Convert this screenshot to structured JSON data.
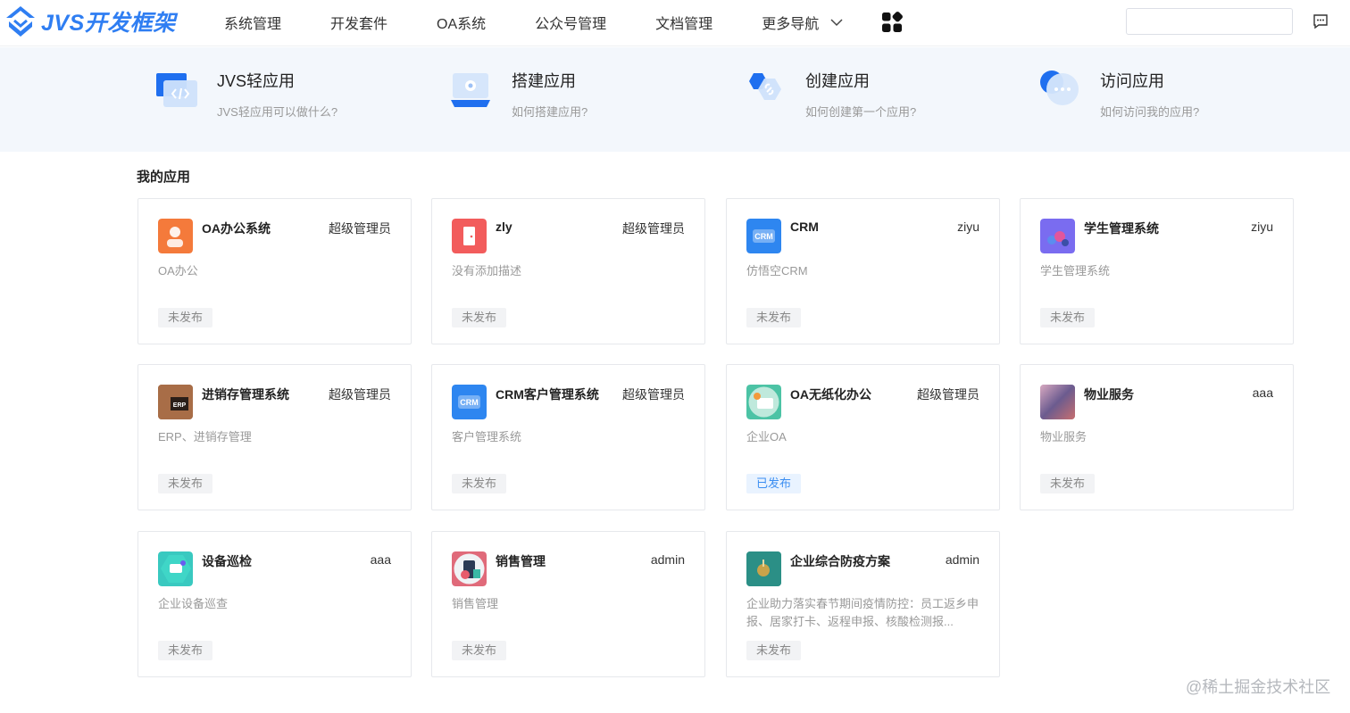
{
  "brand": {
    "logo_text": "JVS开发框架",
    "accent": "#2f7ef2"
  },
  "nav": {
    "items": [
      {
        "label": "系统管理"
      },
      {
        "label": "开发套件"
      },
      {
        "label": "OA系统"
      },
      {
        "label": "公众号管理"
      },
      {
        "label": "文档管理"
      },
      {
        "label": "更多导航",
        "icon": "chevron-down-icon"
      }
    ],
    "apps_icon": "grid-apps-icon",
    "search": {
      "value": "",
      "placeholder": ""
    },
    "message_icon": "message-icon"
  },
  "features": [
    {
      "title": "JVS轻应用",
      "subtitle": "JVS轻应用可以做什么?",
      "icon": "code-window-icon"
    },
    {
      "title": "搭建应用",
      "subtitle": "如何搭建应用?",
      "icon": "monitor-gear-icon"
    },
    {
      "title": "创建应用",
      "subtitle": "如何创建第一个应用?",
      "icon": "hexagon-link-icon"
    },
    {
      "title": "访问应用",
      "subtitle": "如何访问我的应用?",
      "icon": "chat-dots-icon"
    }
  ],
  "my_apps": {
    "title": "我的应用",
    "cards": [
      {
        "name": "OA办公系统",
        "owner": "超级管理员",
        "desc": "OA办公",
        "status": "未发布",
        "published": false,
        "icon_color": "#f47a3b"
      },
      {
        "name": "zly",
        "owner": "超级管理员",
        "desc": "没有添加描述",
        "status": "未发布",
        "published": false,
        "icon_color": "#f25c5c"
      },
      {
        "name": "CRM",
        "owner": "ziyu",
        "desc": "仿悟空CRM",
        "status": "未发布",
        "published": false,
        "icon_color": "#2e86f0"
      },
      {
        "name": "学生管理系统",
        "owner": "ziyu",
        "desc": "学生管理系统",
        "status": "未发布",
        "published": false,
        "icon_color": "#7a6cf0"
      },
      {
        "name": "进销存管理系统",
        "owner": "超级管理员",
        "desc": "ERP、进销存管理",
        "status": "未发布",
        "published": false,
        "icon_color": "#8b5a3c"
      },
      {
        "name": "CRM客户管理系统",
        "owner": "超级管理员",
        "desc": "客户管理系统",
        "status": "未发布",
        "published": false,
        "icon_color": "#2e86f0"
      },
      {
        "name": "OA无纸化办公",
        "owner": "超级管理员",
        "desc": "企业OA",
        "status": "已发布",
        "published": true,
        "icon_color": "#4cc3a5"
      },
      {
        "name": "物业服务",
        "owner": "aaa",
        "desc": "物业服务",
        "status": "未发布",
        "published": false,
        "icon_color": "#6b5b8f"
      },
      {
        "name": "设备巡检",
        "owner": "aaa",
        "desc": "企业设备巡查",
        "status": "未发布",
        "published": false,
        "icon_color": "#39c9c0"
      },
      {
        "name": "销售管理",
        "owner": "admin",
        "desc": "销售管理",
        "status": "未发布",
        "published": false,
        "icon_color": "#e06a7a"
      },
      {
        "name": "企业综合防疫方案",
        "owner": "admin",
        "desc": "企业助力落实春节期间疫情防控：员工返乡申报、居家打卡、返程申报、核酸检测报...",
        "status": "未发布",
        "published": false,
        "icon_color": "#2b8f86"
      }
    ]
  },
  "watermark": "@稀土掘金技术社区"
}
